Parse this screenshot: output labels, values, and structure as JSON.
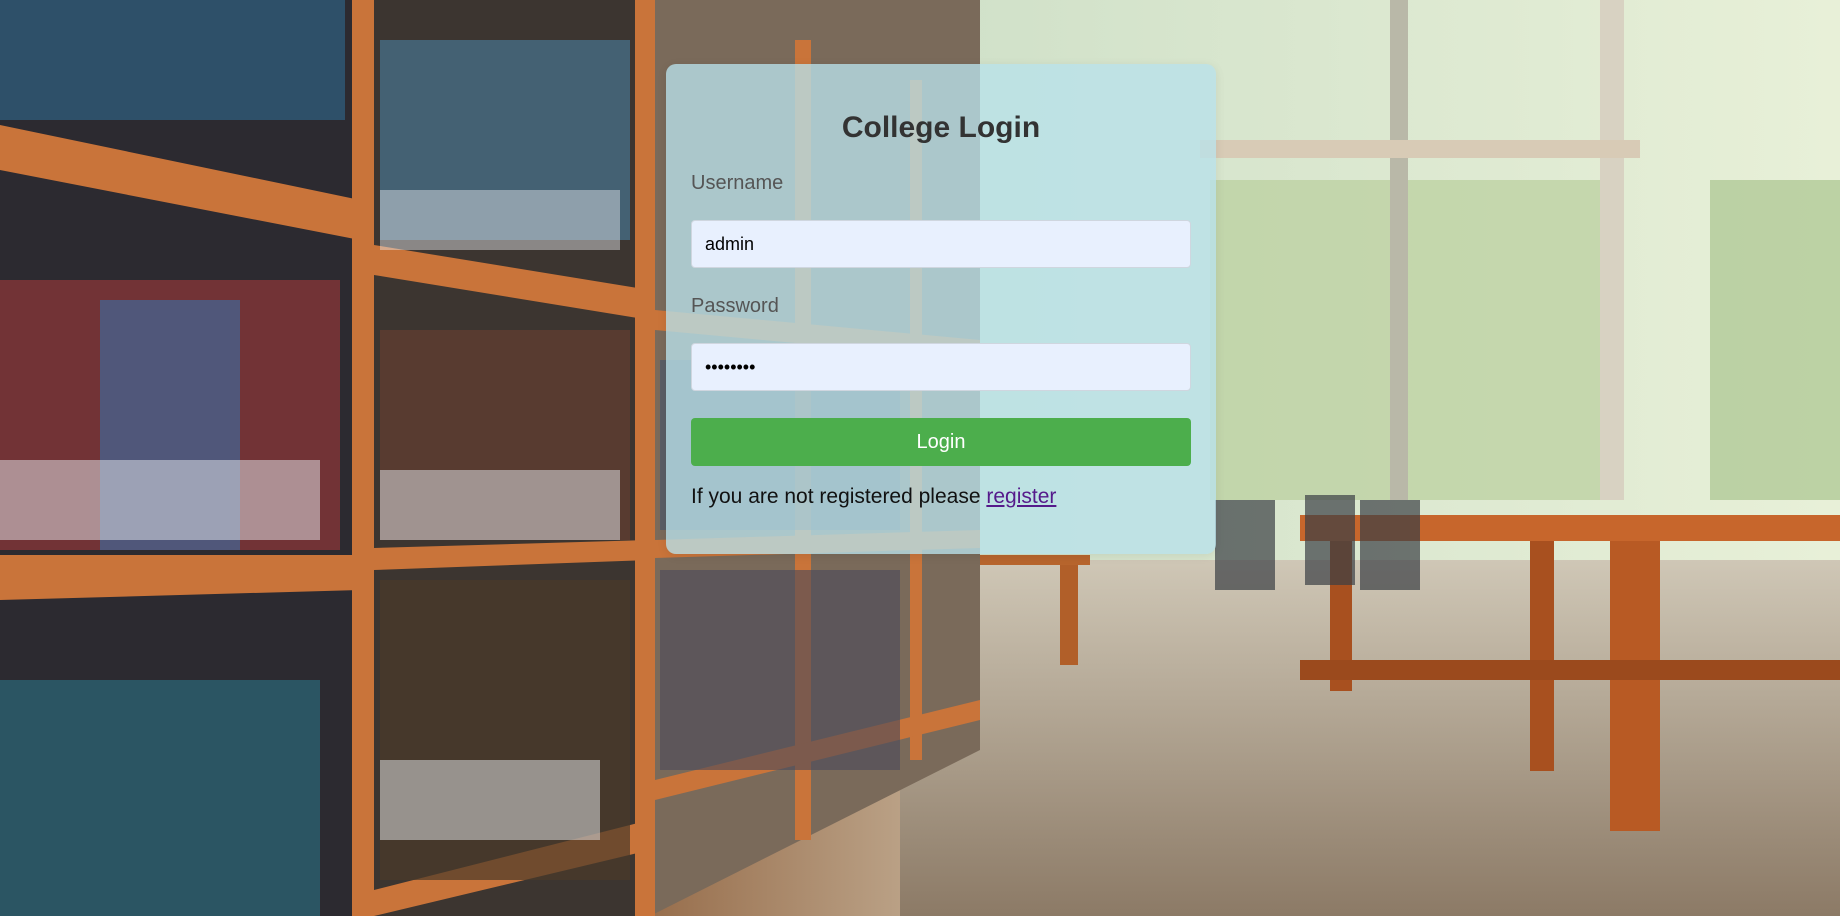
{
  "login": {
    "title": "College Login",
    "username_label": "Username",
    "username_value": "admin",
    "password_label": "Password",
    "password_value": "password",
    "button_label": "Login",
    "register_text": "If you are not registered please",
    "register_link": "register"
  },
  "colors": {
    "card_bg": "#b9e1eb",
    "button_bg": "#4cae4c",
    "input_bg": "#e8f0fe",
    "link": "#551a8b"
  }
}
